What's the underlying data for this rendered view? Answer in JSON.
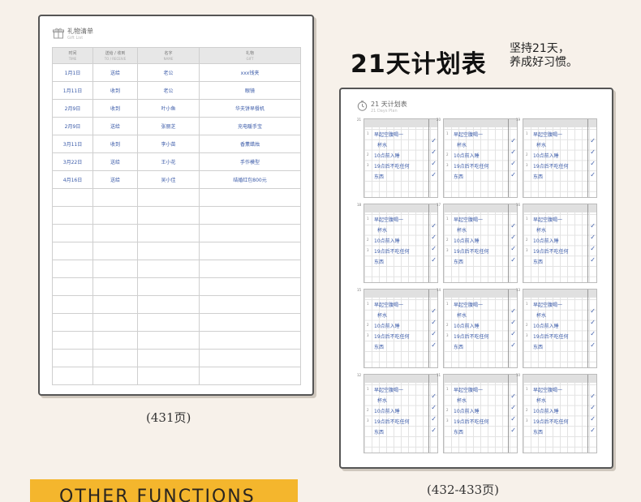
{
  "gift_list": {
    "title": "礼物清单",
    "subtitle": "Gift List",
    "columns": [
      {
        "zh": "时间",
        "en": "TIME"
      },
      {
        "zh": "送给 / 收到",
        "en": "TO / RECEIVE"
      },
      {
        "zh": "名字",
        "en": "NAME"
      },
      {
        "zh": "礼物",
        "en": "GIFT"
      }
    ],
    "rows": [
      [
        "1月1日",
        "送给",
        "老公",
        "xxx钱夹"
      ],
      [
        "1月11日",
        "收到",
        "老公",
        "眼镜"
      ],
      [
        "2月9日",
        "收到",
        "叶小鱼",
        "华夫饼早餐机"
      ],
      [
        "2月9日",
        "送给",
        "张丽芝",
        "充电暖手宝"
      ],
      [
        "3月11日",
        "收到",
        "李小苗",
        "香薰蜡烛"
      ],
      [
        "3月22日",
        "送给",
        "王小花",
        "手作模型"
      ],
      [
        "4月16日",
        "送给",
        "吴小佳",
        "结婚红包800元"
      ]
    ],
    "empty_rows": 11
  },
  "caption_left": "(431页)",
  "header": {
    "main": "21天计划表",
    "side_line1": "坚持21天，",
    "side_line2": "养成好习惯。"
  },
  "days_plan": {
    "title": "21 天计划表",
    "subtitle": "21 Days Plan",
    "task_numbers": [
      "1",
      "2",
      "3"
    ],
    "cards": [
      {
        "number": "21",
        "l1": "早起空腹喝一",
        "l2": "杯水",
        "l3": "10点前入睡",
        "l4": "19点后不吃任何",
        "l5": "东西"
      },
      {
        "number": "20",
        "l1": "早起空腹喝一",
        "l2": "杯水",
        "l3": "10点前入睡",
        "l4": "19点后不吃任何",
        "l5": "东西"
      },
      {
        "number": "19",
        "l1": "早起空腹喝一",
        "l2": "杯水",
        "l3": "10点前入睡",
        "l4": "19点后不吃任何",
        "l5": "东西"
      },
      {
        "number": "18",
        "l1": "早起空腹喝一",
        "l2": "杯水",
        "l3": "10点前入睡",
        "l4": "19点后不吃任何",
        "l5": "东西"
      },
      {
        "number": "17",
        "l1": "早起空腹喝一",
        "l2": "杯水",
        "l3": "10点前入睡",
        "l4": "19点后不吃任何",
        "l5": "东西"
      },
      {
        "number": "16",
        "l1": "早起空腹喝一",
        "l2": "杯水",
        "l3": "10点前入睡",
        "l4": "19点后不吃任何",
        "l5": "东西"
      },
      {
        "number": "15",
        "l1": "早起空腹喝一",
        "l2": "杯水",
        "l3": "10点前入睡",
        "l4": "19点后不吃任何",
        "l5": "东西"
      },
      {
        "number": "14",
        "l1": "早起空腹喝一",
        "l2": "杯水",
        "l3": "10点前入睡",
        "l4": "19点后不吃任何",
        "l5": "东西"
      },
      {
        "number": "13",
        "l1": "早起空腹喝一",
        "l2": "杯水",
        "l3": "10点前入睡",
        "l4": "19点后不吃任何",
        "l5": "东西"
      },
      {
        "number": "12",
        "l1": "早起空腹喝一",
        "l2": "杯水",
        "l3": "10点前入睡",
        "l4": "19点后不吃任何",
        "l5": "东西"
      },
      {
        "number": "11",
        "l1": "早起空腹喝一",
        "l2": "杯水",
        "l3": "10点前入睡",
        "l4": "19点后不吃任何",
        "l5": "东西"
      },
      {
        "number": "10",
        "l1": "早起空腹喝一",
        "l2": "杯水",
        "l3": "10点前入睡",
        "l4": "19点后不吃任何",
        "l5": "东西"
      }
    ]
  },
  "caption_right": "(432-433页)",
  "banner": "OTHER FUNCTIONS",
  "colors": {
    "background": "#f7f1ea",
    "ink_blue": "#3a5aa8",
    "banner": "#f4b62d"
  },
  "icons": [
    "gift-icon",
    "clock-icon",
    "check-icon"
  ]
}
